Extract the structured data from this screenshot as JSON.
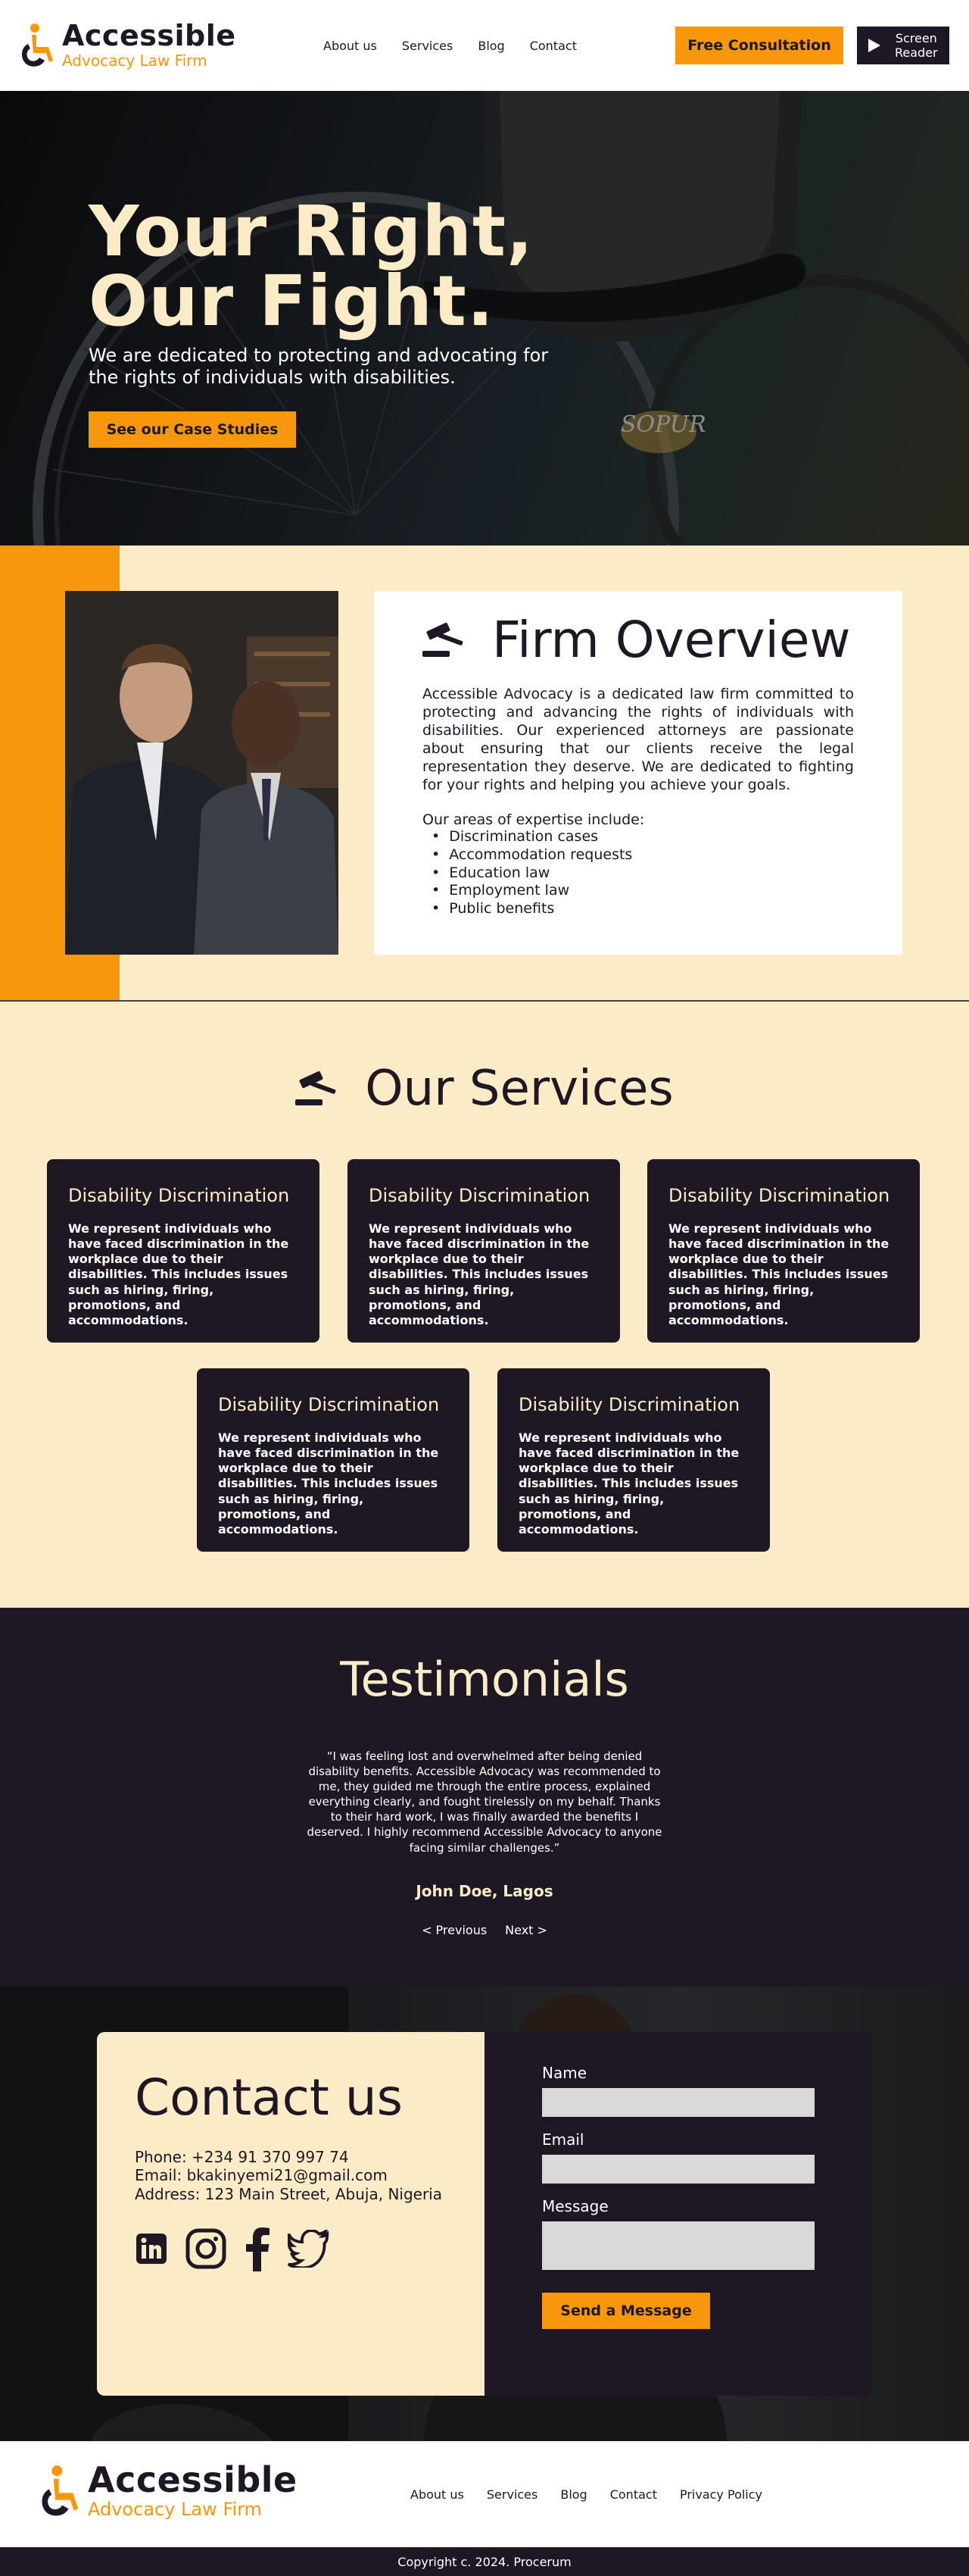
{
  "header": {
    "logo_name": "Accessible",
    "logo_sub": "Advocacy Law Firm",
    "nav": [
      "About us",
      "Services",
      "Blog",
      "Contact"
    ],
    "consult_label": "Free Consultation",
    "reader_label_1": "Screen",
    "reader_label_2": "Reader"
  },
  "hero": {
    "title_line1": "Your Right,",
    "title_line2": "Our Fight.",
    "subtitle": "We are dedicated to protecting and advocating for the rights of individuals with disabilities.",
    "cta_label": "See our Case Studies"
  },
  "overview": {
    "title": "Firm Overview",
    "text": "Accessible Advocacy is a dedicated law firm committed to protecting and advancing the rights of individuals with disabilities. Our experienced attorneys are passionate about ensuring that our clients receive the legal representation they deserve. We are dedicated to fighting for your rights and helping you achieve your goals.",
    "areas_intro": "Our areas of expertise include:",
    "areas": [
      "Discrimination cases",
      "Accommodation requests",
      "Education law",
      "Employment law",
      "Public benefits"
    ]
  },
  "services": {
    "title": "Our Services",
    "cards": [
      {
        "title": "Disability Discrimination",
        "text": "We represent individuals who have faced discrimination in the workplace due to their disabilities. This includes issues such as hiring, firing, promotions, and accommodations."
      },
      {
        "title": "Disability Discrimination",
        "text": "We represent individuals who have faced discrimination in the workplace due to their disabilities. This includes issues such as hiring, firing, promotions, and accommodations."
      },
      {
        "title": "Disability Discrimination",
        "text": "We represent individuals who have faced discrimination in the workplace due to their disabilities. This includes issues such as hiring, firing, promotions, and accommodations."
      },
      {
        "title": "Disability Discrimination",
        "text": "We represent individuals who have faced discrimination in the workplace due to their disabilities. This includes issues such as hiring, firing, promotions, and accommodations."
      },
      {
        "title": "Disability Discrimination",
        "text": "We represent individuals who have faced discrimination in the workplace due to their disabilities. This includes issues such as hiring, firing, promotions, and accommodations."
      }
    ]
  },
  "testimonials": {
    "title": "Testimonials",
    "quote": "“I was feeling lost and overwhelmed after being denied disability benefits. Accessible Advocacy was recommended to me, they guided me through the entire process, explained everything clearly, and fought tirelessly on my behalf. Thanks to their hard work, I was finally awarded the benefits I deserved. I highly recommend Accessible Advocacy to anyone facing similar challenges.”",
    "author": "John Doe, Lagos",
    "prev_label": "< Previous",
    "next_label": "Next >"
  },
  "contact": {
    "title": "Contact us",
    "phone": "Phone: +234 91 370 997 74",
    "email": "Email: bkakinyemi21@gmail.com",
    "address": "Address: 123 Main Street, Abuja, Nigeria",
    "name_label": "Name",
    "email_label": "Email",
    "message_label": "Message",
    "name_value": "",
    "email_value": "",
    "message_value": "",
    "send_label": "Send a Message",
    "socials": [
      "linkedin-icon",
      "instagram-icon",
      "facebook-icon",
      "twitter-icon"
    ]
  },
  "footer": {
    "logo_name": "Accessible",
    "logo_sub": "Advocacy Law Firm",
    "nav": [
      "About us",
      "Services",
      "Blog",
      "Contact",
      "Privacy Policy"
    ],
    "copyright": "Copyright c. 2024.  Procerum"
  },
  "colors": {
    "accent": "#f8970c",
    "dark": "#1d1824",
    "cream": "#fbebc6"
  }
}
